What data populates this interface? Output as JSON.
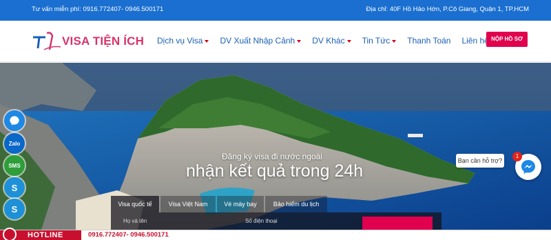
{
  "topbar": {
    "hotline_text": "Tư vấn miễn phí: 0916.772407- 0946.500171",
    "address_text": "Địa chỉ: 40F Hồ Hảo Hớn, P.Cô Giang, Quận 1, TP.HCM"
  },
  "header": {
    "logo_text": "VISA TIỆN ÍCH",
    "nav": [
      {
        "label": "Dịch vụ Visa",
        "has_dropdown": true
      },
      {
        "label": "DV Xuất Nhập Cảnh",
        "has_dropdown": true
      },
      {
        "label": "DV Khác",
        "has_dropdown": true
      },
      {
        "label": "Tin Tức",
        "has_dropdown": true
      },
      {
        "label": "Thanh Toán",
        "has_dropdown": false
      },
      {
        "label": "Liên hệ",
        "has_dropdown": false
      }
    ],
    "apply_button": "NỘP HỒ SƠ"
  },
  "hero": {
    "subtitle": "Đăng ký visa đi nước ngoài",
    "title": "nhận kết quả trong 24h",
    "tabs": [
      {
        "label": "Visa quốc tế",
        "active": true
      },
      {
        "label": "Visa Việt Nam",
        "active": false
      },
      {
        "label": "Vé máy bay",
        "active": false
      },
      {
        "label": "Bảo hiểm du lịch",
        "active": false
      }
    ],
    "field_1": "Họ và tên",
    "field_2": "Số điện thoại"
  },
  "social": [
    {
      "icon": "messenger-icon",
      "label": "",
      "color": "#1e88e5"
    },
    {
      "icon": "zalo-icon",
      "label": "Zalo",
      "color": "#0a68c9"
    },
    {
      "icon": "sms-icon",
      "label": "SMS",
      "color": "#2e9e3a"
    },
    {
      "icon": "skype-icon",
      "label": "S",
      "color": "#1e90d8"
    },
    {
      "icon": "skype-icon",
      "label": "S",
      "color": "#1e90d8"
    }
  ],
  "chat": {
    "bubble_text": "Bạn cần hỗ trợ?",
    "badge": "1"
  },
  "hotline": {
    "label": "HOTLINE",
    "numbers": "0916.772407- 0946.500171"
  },
  "colors": {
    "topbar": "#1a6fd0",
    "brand_pink": "#d6336c",
    "nav_blue": "#1a5fb4",
    "accent_red": "#e0004d",
    "hotline_red": "#c8102e"
  }
}
